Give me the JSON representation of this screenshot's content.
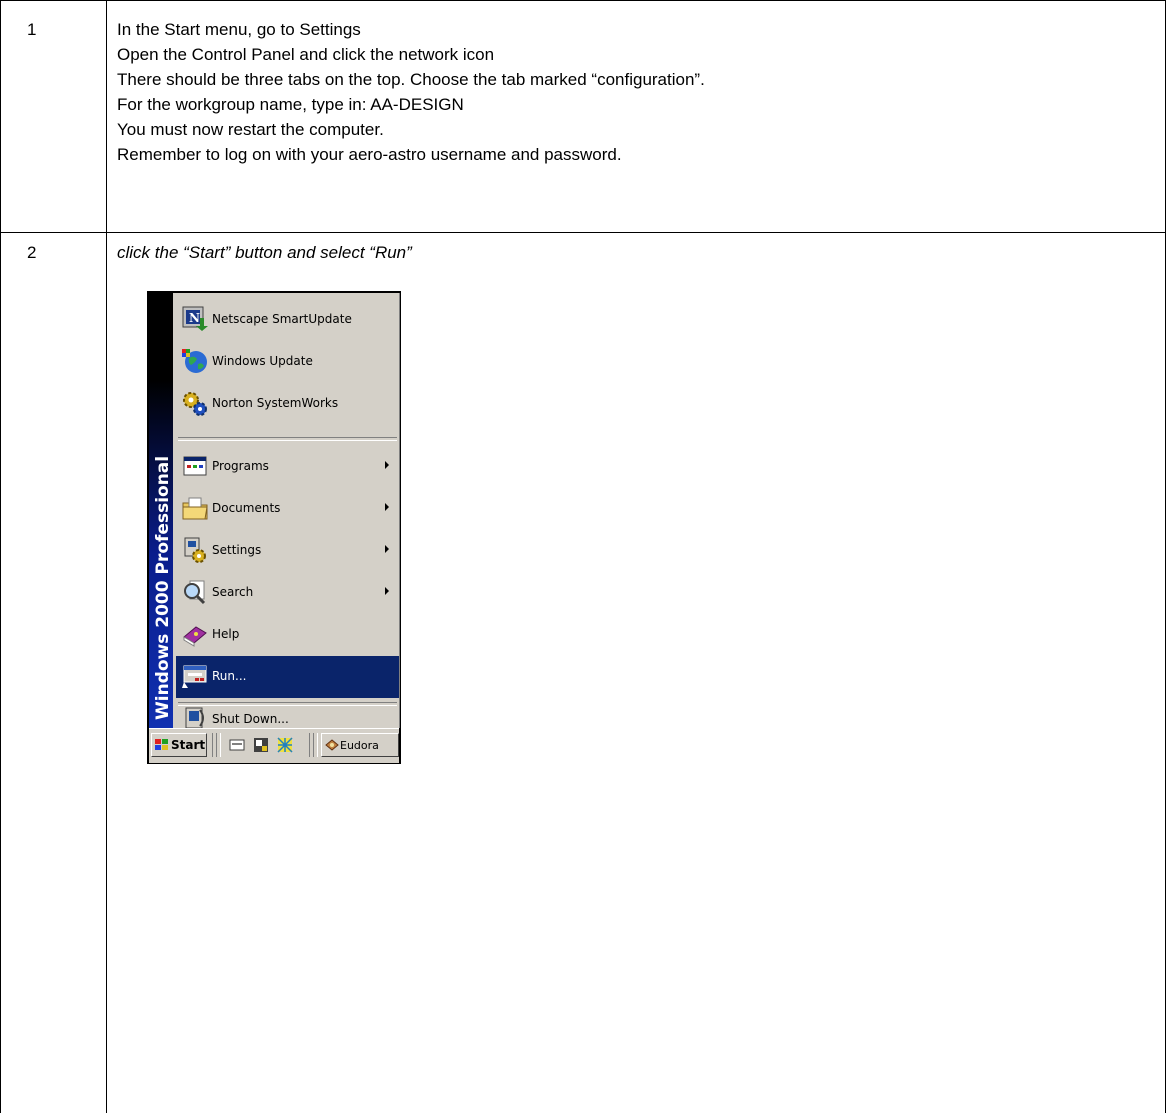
{
  "steps": [
    {
      "number": "1",
      "lines": [
        "In the Start menu, go to Settings",
        "Open the Control Panel and click the network icon",
        "There should be three tabs on the top.  Choose the tab marked “configuration”.",
        "For the workgroup name, type in: AA-DESIGN",
        "You must now restart the computer.",
        "Remember to log on with your aero-astro username and password."
      ]
    },
    {
      "number": "2",
      "lines": [
        "click the “Start” button and select “Run”"
      ]
    }
  ],
  "start_menu": {
    "banner_text": "Windows 2000 Professional",
    "items": [
      {
        "label": "Netscape SmartUpdate",
        "icon": "netscape-icon"
      },
      {
        "label": "Windows Update",
        "icon": "globe-icon"
      },
      {
        "label": "Norton SystemWorks",
        "icon": "gears-icon"
      },
      {
        "label": "Programs",
        "icon": "programs-icon",
        "submenu": true
      },
      {
        "label": "Documents",
        "icon": "folder-icon",
        "submenu": true
      },
      {
        "label": "Settings",
        "icon": "settings-icon",
        "submenu": true
      },
      {
        "label": "Search",
        "icon": "search-icon",
        "submenu": true
      },
      {
        "label": "Help",
        "icon": "help-book-icon"
      },
      {
        "label": "Run...",
        "icon": "run-icon",
        "selected": true
      },
      {
        "label": "Shut Down...",
        "icon": "shutdown-icon"
      }
    ],
    "selection_color": "#0a246a",
    "menu_color": "#d4d0c8"
  },
  "taskbar": {
    "start_label": "Start",
    "task_label": "Eudora"
  }
}
